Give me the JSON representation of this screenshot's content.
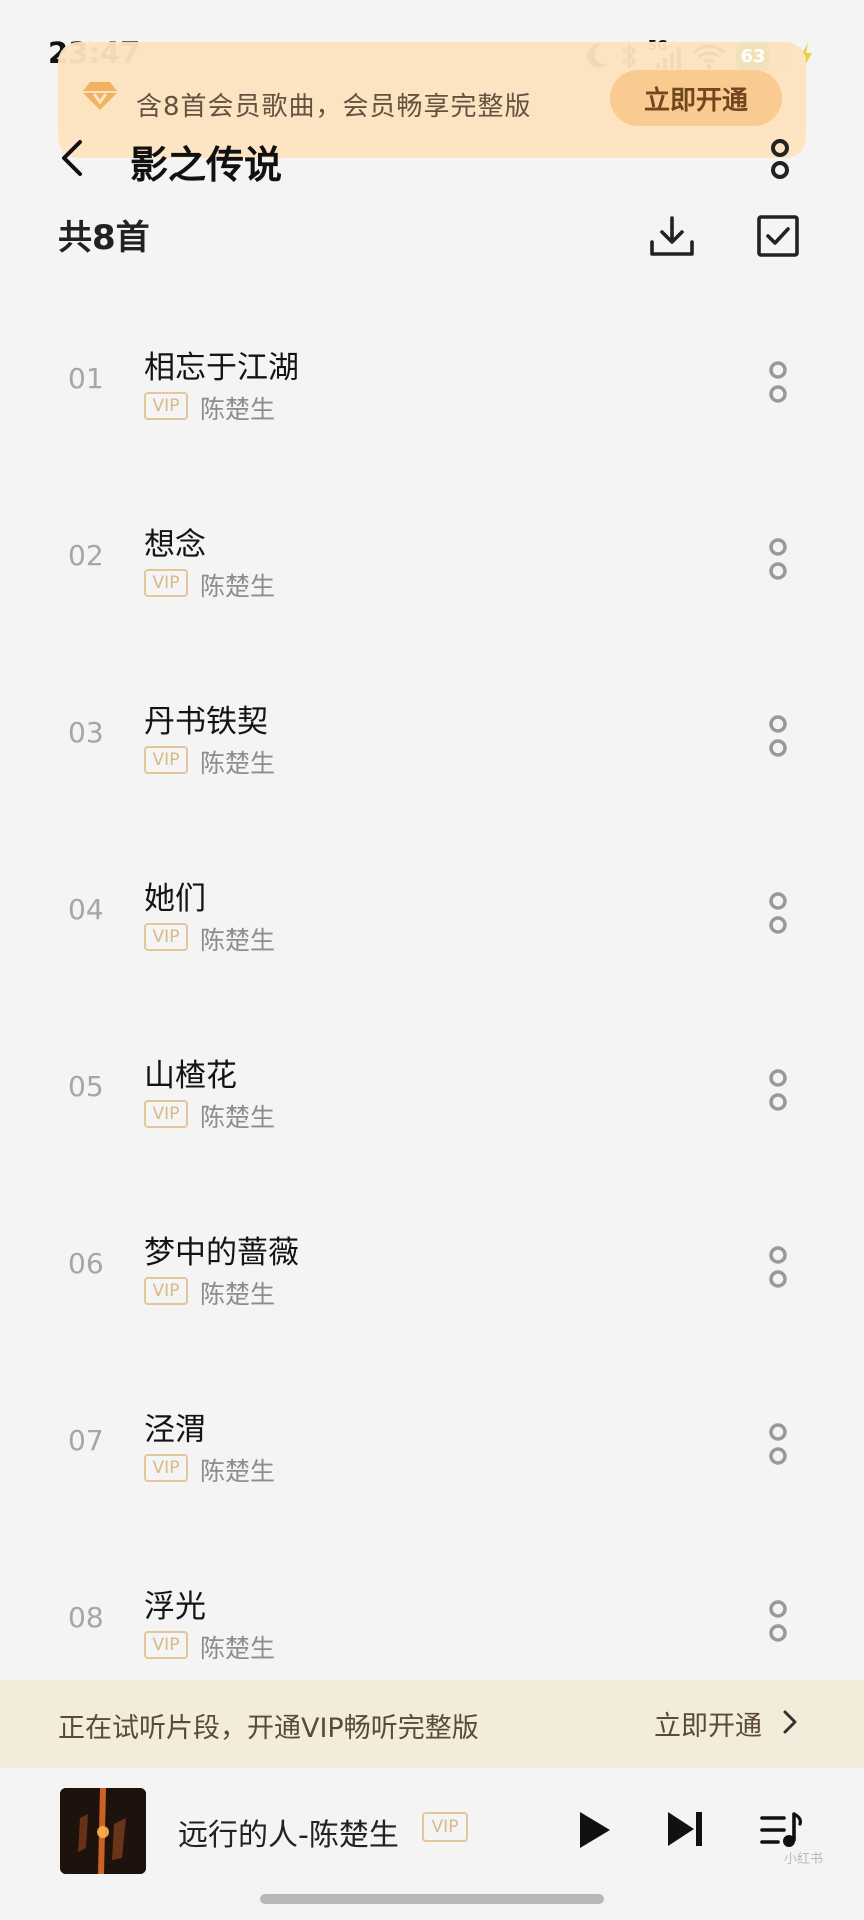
{
  "status": {
    "time": "23:47",
    "network": "5G",
    "battery": "63",
    "battery_level": 0.63
  },
  "vip_banner": {
    "text": "含8首会员歌曲，会员畅享完整版",
    "button": "立即开通"
  },
  "header": {
    "title": "影之传说"
  },
  "list_header": {
    "count_label": "共8首"
  },
  "songs": [
    {
      "num": "01",
      "title": "相忘于江湖",
      "tag": "VIP",
      "artist": "陈楚生"
    },
    {
      "num": "02",
      "title": "想念",
      "tag": "VIP",
      "artist": "陈楚生"
    },
    {
      "num": "03",
      "title": "丹书铁契",
      "tag": "VIP",
      "artist": "陈楚生"
    },
    {
      "num": "04",
      "title": "她们",
      "tag": "VIP",
      "artist": "陈楚生"
    },
    {
      "num": "05",
      "title": "山楂花",
      "tag": "VIP",
      "artist": "陈楚生"
    },
    {
      "num": "06",
      "title": "梦中的蔷薇",
      "tag": "VIP",
      "artist": "陈楚生"
    },
    {
      "num": "07",
      "title": "泾渭",
      "tag": "VIP",
      "artist": "陈楚生"
    },
    {
      "num": "08",
      "title": "浮光",
      "tag": "VIP",
      "artist": "陈楚生"
    }
  ],
  "trial": {
    "text": "正在试听片段，开通VIP畅听完整版",
    "link": "立即开通"
  },
  "player": {
    "now_playing": "远行的人-陈楚生",
    "tag": "VIP",
    "watermark": "小红书"
  },
  "colors": {
    "accent_gold": "#fbc98b",
    "vip_border": "#e3c79b",
    "battery_green": "#32c34a"
  }
}
